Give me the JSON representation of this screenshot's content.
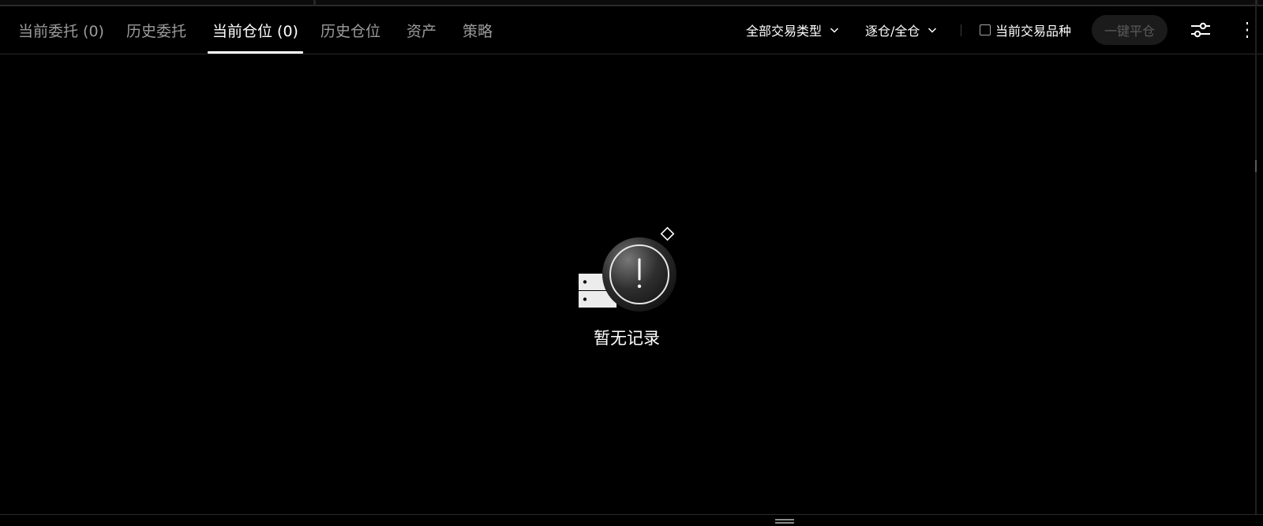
{
  "tabs": [
    {
      "label": "当前委托 (0)",
      "active": false
    },
    {
      "label": "历史委托",
      "active": false
    },
    {
      "label": "当前仓位 (0)",
      "active": true
    },
    {
      "label": "历史仓位",
      "active": false
    },
    {
      "label": "资产",
      "active": false
    },
    {
      "label": "策略",
      "active": false
    }
  ],
  "controls": {
    "trade_type_dropdown": "全部交易类型",
    "margin_mode_dropdown": "逐仓/全仓",
    "current_symbol_checkbox": "当前交易品种",
    "close_all_button": "一键平仓"
  },
  "empty_state": {
    "text": "暂无记录",
    "icon": "warning-icon"
  },
  "colors": {
    "background": "#000000",
    "active_text": "#ffffff",
    "inactive_text": "#9b9b9b",
    "disabled_button_bg": "#1b1b1b",
    "disabled_button_text": "#5c5c5c"
  }
}
